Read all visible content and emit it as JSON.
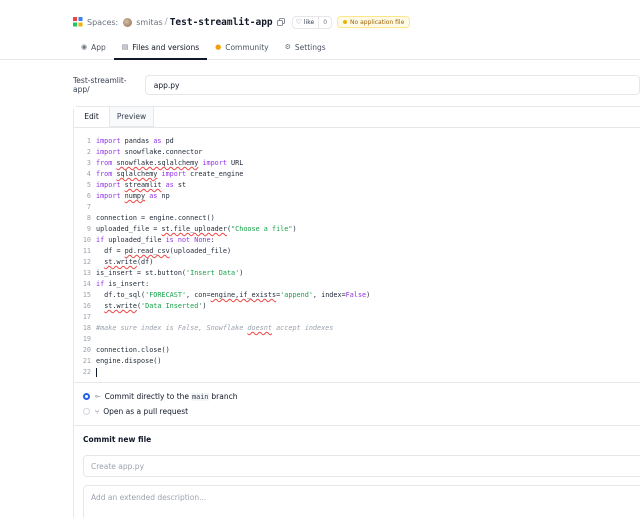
{
  "header": {
    "spaces_label": "Spaces:",
    "owner": "smitas",
    "separator": "/",
    "repo_name": "Test-streamlit-app",
    "like_label": "like",
    "like_count": "0",
    "status_badge": "No application file"
  },
  "tabs": [
    {
      "label": "App",
      "icon": "app-icon"
    },
    {
      "label": "Files and versions",
      "icon": "files-icon"
    },
    {
      "label": "Community",
      "icon": "community-icon"
    },
    {
      "label": "Settings",
      "icon": "gear-icon"
    }
  ],
  "path": {
    "prefix": "Test-streamlit-app/",
    "filename": "app.py"
  },
  "editor": {
    "tabs": [
      "Edit",
      "Preview"
    ],
    "line_numbers": [
      "1",
      "2",
      "3",
      "4",
      "5",
      "6",
      "7",
      "8",
      "9",
      "10",
      "11",
      "12",
      "13",
      "14",
      "15",
      "16",
      "17",
      "18",
      "19",
      "20",
      "21",
      "22"
    ],
    "lines": {
      "l1": {
        "a": "import",
        "b": " pandas ",
        "c": "as",
        "d": " pd"
      },
      "l2": {
        "a": "import",
        "b": " snowflake.connector"
      },
      "l3": {
        "a": "from",
        "b": "snowflake.sqlalchemy",
        "c": "import",
        "d": " URL"
      },
      "l4": {
        "a": "from",
        "b": "sqlalchemy",
        "c": "import",
        "d": " create_engine"
      },
      "l5": {
        "a": "import",
        "b": "streamlit",
        "c": "as",
        "d": " st"
      },
      "l6": {
        "a": "import",
        "b": "numpy",
        "c": "as",
        "d": " np"
      },
      "l7": "",
      "l8": "connection = engine.connect()",
      "l9": {
        "a": "uploaded_file = ",
        "b": "st.file_uploader",
        "c": "(",
        "d": "\"Choose a file\"",
        "e": ")"
      },
      "l10": {
        "a": "if",
        "b": " uploaded_file ",
        "c": "is not None",
        "d": ":"
      },
      "l11": {
        "a": "  df = ",
        "b": "pd.read_csv",
        "c": "(uploaded_file)"
      },
      "l12": {
        "a": "  ",
        "b": "st.write",
        "c": "(df)"
      },
      "l13": {
        "a": "is_insert = st.button(",
        "b": "'Insert Data'",
        "c": ")"
      },
      "l14": {
        "a": "if",
        "b": " is_insert:"
      },
      "l15": {
        "a": "  df.to_sql(",
        "b": "'FORECAST'",
        "c": ", con=",
        "d": "engine,if_exists",
        "e": "=",
        "f": "'append'",
        "g": ", index=",
        "h": "False",
        "i": ")"
      },
      "l16": {
        "a": "  ",
        "b": "st.write",
        "c": "(",
        "d": "'Data Inserted'",
        "e": ")"
      },
      "l17": "",
      "l18": {
        "a": "#make sure index is False, Snowflake ",
        "b": "doesnt",
        "c": " accept indexes"
      },
      "l19": "",
      "l20": "connection.close()",
      "l21": "engine.dispose()",
      "l22": ""
    }
  },
  "commit": {
    "option_direct_pre": "Commit directly to the",
    "branch": "main",
    "option_direct_post": "branch",
    "option_pr": "Open as a pull request",
    "title": "Commit new file",
    "summary_placeholder": "Create app.py",
    "description_placeholder": "Add an extended description..."
  }
}
